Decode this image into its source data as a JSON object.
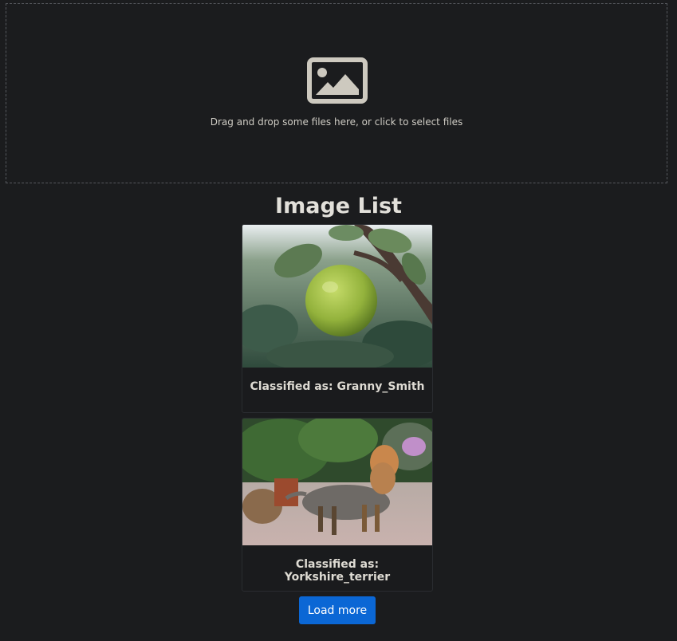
{
  "dropzone": {
    "icon": "image-icon",
    "text": "Drag and drop some files here, or click to select files"
  },
  "image_list": {
    "title": "Image List",
    "items": [
      {
        "image": "green apple on branch",
        "caption": "Classified as: Granny_Smith"
      },
      {
        "image": "yorkshire terrier on path",
        "caption": "Classified as: Yorkshire_terrier"
      }
    ]
  },
  "load_more_label": "Load more",
  "colors": {
    "background": "#1b1c1e",
    "accent": "#0b67d5",
    "text": "#e2e0da"
  }
}
